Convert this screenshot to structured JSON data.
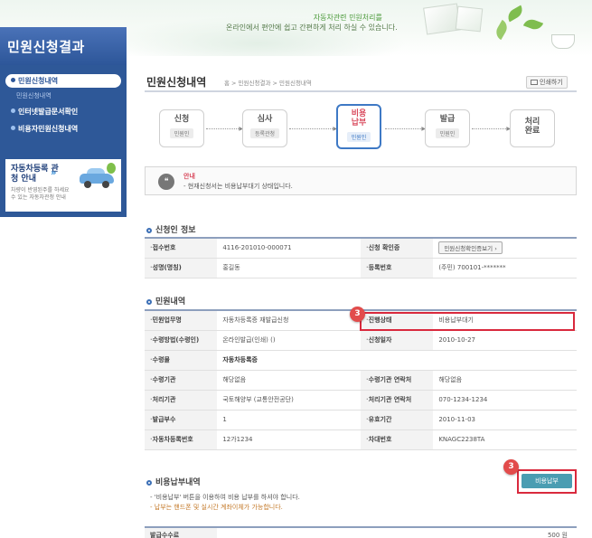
{
  "banner": {
    "line1": "자동차관련 민원처리를",
    "line2": "온라인에서 편안에 쉽고 간편하게 처리 하실 수 있습니다."
  },
  "sidebar": {
    "title": "민원신청결과",
    "items": [
      {
        "label": "민원신청내역",
        "active": true
      },
      {
        "label": "민원신청내역",
        "sub": true
      },
      {
        "label": "인터넷발급문서확인",
        "active": false
      },
      {
        "label": "비용자민원신청내역",
        "active": false
      }
    ],
    "promo": {
      "title": "자동차등록 관청 안내",
      "desc": "차량이 반영된주를 하세요 수 있는 자동차관청 안내"
    }
  },
  "header": {
    "title": "민원신청내역",
    "breadcrumb": "홈 > 민원신청결과 > 민원신청내역",
    "print_label": "인쇄하기"
  },
  "steps": [
    {
      "name": "신청",
      "role": "민원인",
      "active": false
    },
    {
      "name": "심사",
      "role": "등록관청",
      "active": false
    },
    {
      "name": "비용\n납부",
      "role": "민원인",
      "active": true
    },
    {
      "name": "발급",
      "role": "민원인",
      "active": false
    },
    {
      "name": "처리\n완료",
      "role": "",
      "active": false
    }
  ],
  "notice": {
    "title": "안내",
    "text": "- 현재신청서는 비용납부대기 상태입니다."
  },
  "applicant": {
    "section_title": "신청인 정보",
    "rows": [
      {
        "l1": "접수번호",
        "v1": "4116-201010-000071",
        "l2": "신청 확인증",
        "v2": "",
        "button": "민원신청확인증보기 ›"
      },
      {
        "l1": "성명(명칭)",
        "v1": "홍길동",
        "l2": "등록번호",
        "v2": "(주민) 700101-*******"
      }
    ]
  },
  "complaint": {
    "section_title": "민원내역",
    "rows": [
      {
        "l1": "민원업무명",
        "v1": "자동차등록증 재발급신청",
        "l2": "진행상태",
        "v2": "비용납부대기"
      },
      {
        "l1": "수령방법(수령인)",
        "v1": "온라인발급(인쇄) ()",
        "l2": "신청일자",
        "v2": "2010-10-27"
      },
      {
        "l1": "수령물",
        "v1": "자동차등록증",
        "l2": "",
        "v2": ""
      },
      {
        "l1": "수령기관",
        "v1": "해당없음",
        "l2": "수령기관 연락처",
        "v2": "해당없음"
      },
      {
        "l1": "처리기관",
        "v1": "국토해양부 (교통안전공단)",
        "l2": "처리기관 연락처",
        "v2": "070-1234-1234"
      },
      {
        "l1": "발급부수",
        "v1": "1",
        "l2": "유효기간",
        "v2": "2010-11-03"
      },
      {
        "l1": "자동차등록번호",
        "v1": "12가1234",
        "l2": "차대번호",
        "v2": "KNAGC2238TA"
      }
    ]
  },
  "fee": {
    "section_title": "비용납부내역",
    "pay_label": "비용납부",
    "notes": [
      "- '비용납부' 버튼을 이용하여 비용 납부를 하셔야 합니다.",
      "- 납부는 핸드폰 및 실시간 계좌이체가 가능합니다."
    ],
    "row_label": "발급수수료",
    "row_value": "500 원"
  },
  "markers": {
    "status": "3",
    "pay": "3"
  },
  "colors": {
    "sidebar": "#2d5699",
    "highlight": "#d9293d",
    "pay_button": "#4a9db2"
  }
}
